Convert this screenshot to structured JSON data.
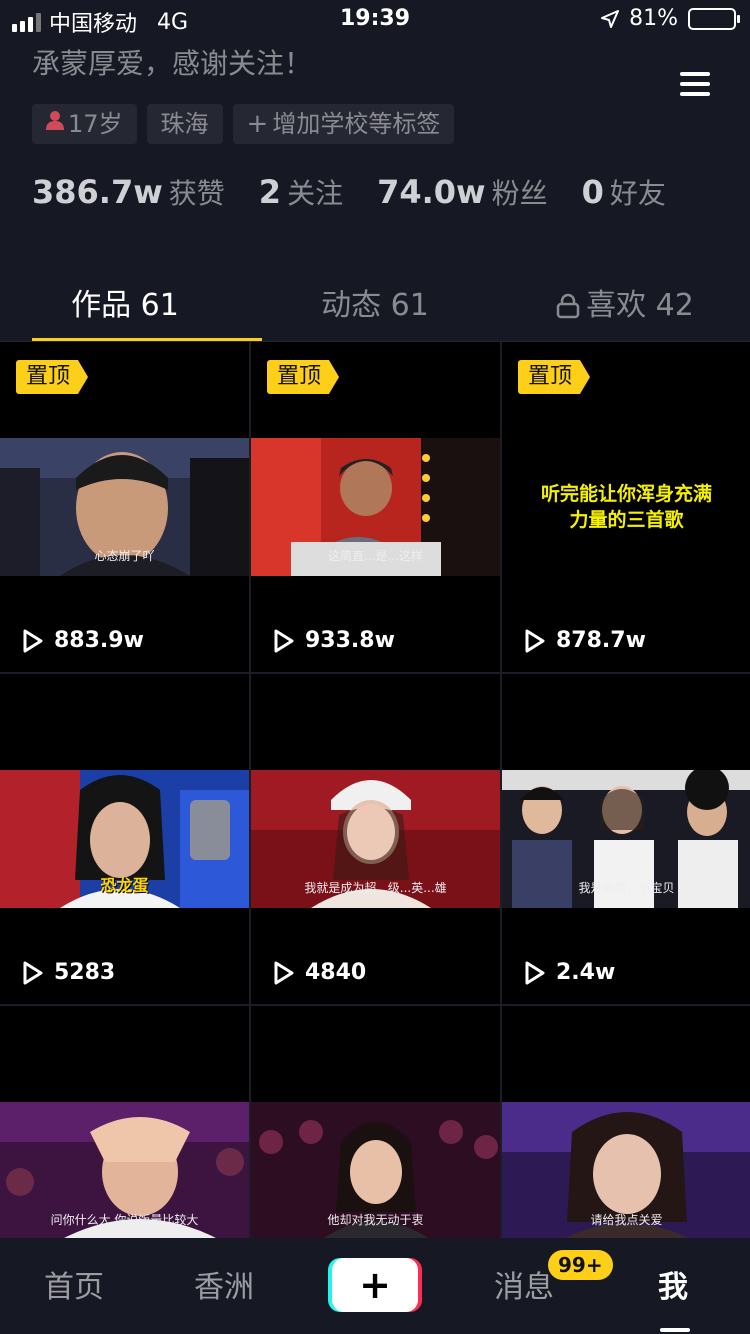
{
  "status_bar": {
    "carrier": "中国移动",
    "network": "4G",
    "time": "19:39",
    "battery": "81%",
    "battery_level": 0.81
  },
  "profile": {
    "bio": "承蒙厚爱，感谢关注！",
    "tags": {
      "age": "17岁",
      "city": "珠海",
      "add": "增加学校等标签"
    },
    "stats": {
      "likes_num": "386.7w",
      "likes_label": "获赞",
      "following_num": "2",
      "following_label": "关注",
      "fans_num": "74.0w",
      "fans_label": "粉丝",
      "friends_num": "0",
      "friends_label": "好友"
    }
  },
  "tabs": {
    "works": "作品 61",
    "moments": "动态 61",
    "likes": "喜欢 42"
  },
  "videos": [
    {
      "pinned": "置顶",
      "plays": "883.9w",
      "caption": "心态崩了吖"
    },
    {
      "pinned": "置顶",
      "plays": "933.8w",
      "caption": "这简直...是...这样"
    },
    {
      "pinned": "置顶",
      "plays": "878.7w",
      "caption": "听完能让你浑身充满力量的三首歌"
    },
    {
      "plays": "5283",
      "caption": "恐龙蛋"
    },
    {
      "plays": "4840",
      "caption": "我就是成为超...级...英...雄"
    },
    {
      "plays": "2.4w",
      "caption": "我是懒猪，小宝贝"
    },
    {
      "caption": "问你什么大  你说饭量比较大"
    },
    {
      "caption": "他却对我无动于衷"
    },
    {
      "caption": "请给我点关爱"
    }
  ],
  "nav": {
    "home": "首页",
    "city": "香洲",
    "plus": "+",
    "messages": "消息",
    "badge": "99+",
    "me": "我"
  },
  "colors": {
    "accent": "#fdcf18",
    "background": "#161823",
    "muted_text": "#8a8b91"
  }
}
